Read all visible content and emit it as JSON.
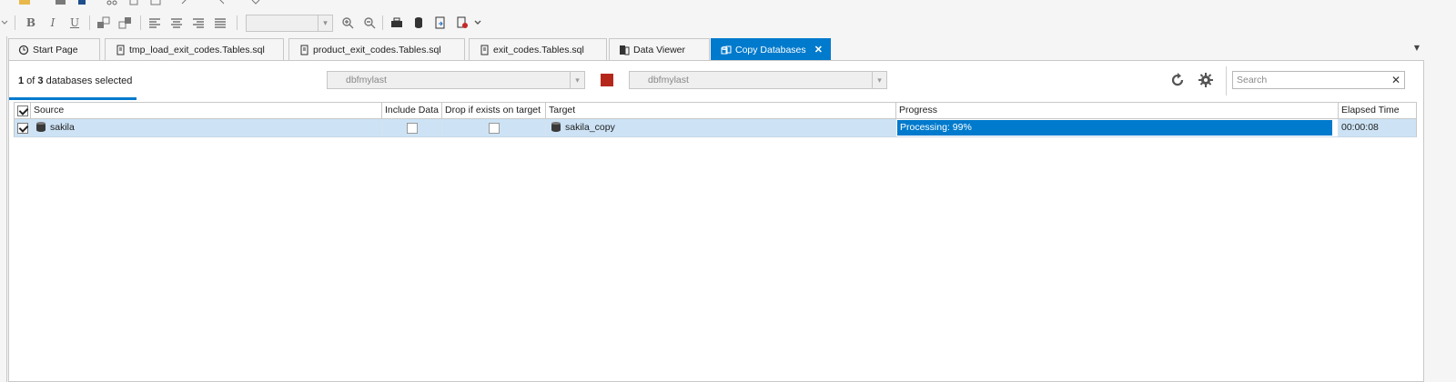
{
  "formatting_toolbar": {
    "bold": "B",
    "italic": "I",
    "underline": "U"
  },
  "tabs": [
    {
      "label": "Start Page",
      "icon": "start-page-icon",
      "active": false
    },
    {
      "label": "tmp_load_exit_codes.Tables.sql",
      "icon": "sql-script-icon",
      "active": false
    },
    {
      "label": "product_exit_codes.Tables.sql",
      "icon": "sql-script-icon",
      "active": false
    },
    {
      "label": "exit_codes.Tables.sql",
      "icon": "sql-script-icon",
      "active": false
    },
    {
      "label": "Data Viewer",
      "icon": "data-viewer-icon",
      "active": false
    },
    {
      "label": "Copy Databases",
      "icon": "copy-databases-icon",
      "active": true
    }
  ],
  "copy_databases": {
    "selection": {
      "selected": "1",
      "middle": " of ",
      "total": "3",
      "suffix": " databases selected"
    },
    "source_connection": "dbfmylast",
    "target_connection": "dbfmylast",
    "search_placeholder": "Search",
    "columns": [
      "Source",
      "Include Data",
      "Drop if exists on target",
      "Target",
      "Progress",
      "Elapsed Time"
    ],
    "rows": [
      {
        "checked": true,
        "source": "sakila",
        "include_data": false,
        "drop_if_exists": false,
        "target": "sakila_copy",
        "progress_text": "Processing: 99%",
        "progress_fraction": 0.99,
        "elapsed": "00:00:08"
      }
    ]
  },
  "colors": {
    "accent": "#007acc",
    "stop": "#b5271a",
    "row_selected": "#cde3f5"
  }
}
